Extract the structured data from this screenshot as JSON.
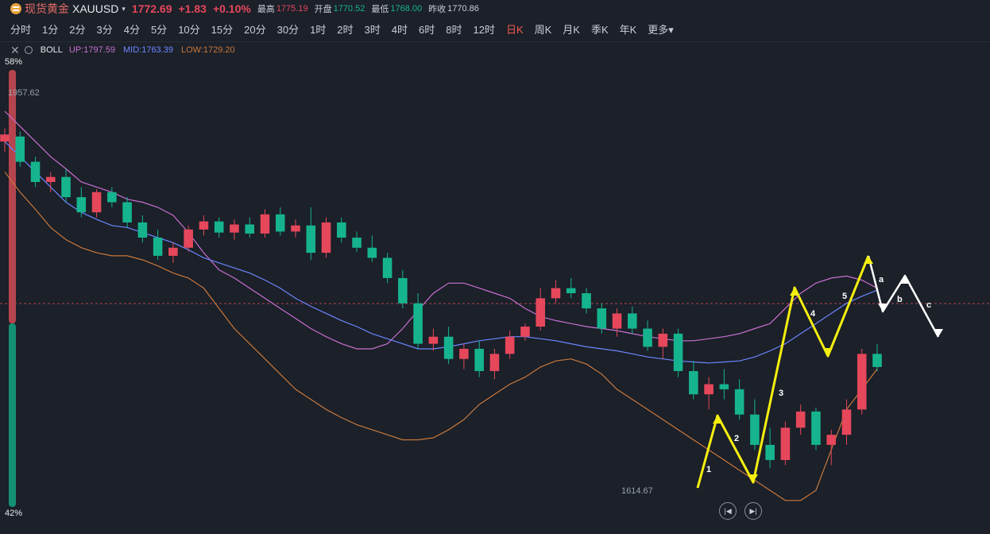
{
  "header": {
    "name": "现货黄金",
    "code": "XAUUSD",
    "caret": "▾",
    "price": "1772.69",
    "change": "+1.83",
    "change_pct": "+0.10%",
    "high_label": "最高",
    "high": "1775.19",
    "open_label": "开盘",
    "open": "1770.52",
    "low_label": "最低",
    "low": "1768.00",
    "prev_label": "昨收",
    "prev": "1770.86"
  },
  "timeframes": [
    "分时",
    "1分",
    "2分",
    "3分",
    "4分",
    "5分",
    "10分",
    "15分",
    "20分",
    "30分",
    "1时",
    "2时",
    "3时",
    "4时",
    "6时",
    "8时",
    "12时",
    "日K",
    "周K",
    "月K",
    "季K",
    "年K",
    "更多"
  ],
  "active_timeframe": "日K",
  "indicator": {
    "name": "BOLL",
    "up": "UP:1797.59",
    "mid": "MID:1763.39",
    "low": "LOW:1729.20"
  },
  "side_percent": {
    "top": "58%",
    "bottom": "42%",
    "top_value": 0.58
  },
  "colors": {
    "bull": "#e6475b",
    "bear": "#16b48e",
    "upper": "#c86fd0",
    "mid": "#6c86ff",
    "lower": "#c9783d",
    "wave": "#f5ef0f",
    "corr": "#ffffff"
  },
  "chart_data": {
    "type": "candlestick",
    "title": "",
    "max_label": "1957.62",
    "min_label": "1614.67",
    "wave_labels": [
      "1",
      "2",
      "3",
      "4",
      "5",
      "a",
      "b",
      "c"
    ],
    "bollinger": {
      "upper": [
        1975,
        1960,
        1945,
        1930,
        1918,
        1905,
        1900,
        1895,
        1888,
        1885,
        1880,
        1872,
        1855,
        1835,
        1818,
        1810,
        1800,
        1790,
        1780,
        1770,
        1760,
        1752,
        1745,
        1740,
        1740,
        1745,
        1760,
        1778,
        1795,
        1805,
        1805,
        1800,
        1795,
        1790,
        1780,
        1772,
        1768,
        1765,
        1762,
        1760,
        1758,
        1755,
        1752,
        1750,
        1748,
        1748,
        1750,
        1752,
        1755,
        1760,
        1765,
        1780,
        1795,
        1805,
        1810,
        1812,
        1808,
        1800
      ],
      "mid": [
        1945,
        1930,
        1915,
        1900,
        1885,
        1875,
        1868,
        1862,
        1860,
        1855,
        1850,
        1845,
        1838,
        1830,
        1825,
        1820,
        1815,
        1808,
        1800,
        1790,
        1782,
        1775,
        1768,
        1762,
        1755,
        1750,
        1745,
        1740,
        1740,
        1742,
        1745,
        1748,
        1750,
        1752,
        1752,
        1750,
        1748,
        1745,
        1742,
        1740,
        1738,
        1735,
        1732,
        1730,
        1728,
        1727,
        1726,
        1727,
        1728,
        1732,
        1738,
        1745,
        1755,
        1765,
        1775,
        1785,
        1792,
        1798
      ],
      "lower": [
        1915,
        1895,
        1878,
        1860,
        1848,
        1840,
        1835,
        1832,
        1832,
        1828,
        1822,
        1815,
        1810,
        1800,
        1780,
        1760,
        1745,
        1730,
        1715,
        1700,
        1690,
        1680,
        1672,
        1665,
        1660,
        1655,
        1650,
        1650,
        1652,
        1660,
        1670,
        1685,
        1695,
        1705,
        1712,
        1722,
        1728,
        1730,
        1725,
        1715,
        1700,
        1690,
        1680,
        1670,
        1660,
        1650,
        1640,
        1630,
        1620,
        1610,
        1600,
        1590,
        1590,
        1600,
        1640,
        1680,
        1700,
        1720
      ]
    },
    "candles": [
      {
        "o": 1945,
        "h": 1958,
        "l": 1935,
        "c": 1952
      },
      {
        "o": 1950,
        "h": 1955,
        "l": 1920,
        "c": 1925
      },
      {
        "o": 1925,
        "h": 1930,
        "l": 1900,
        "c": 1905
      },
      {
        "o": 1905,
        "h": 1915,
        "l": 1895,
        "c": 1910
      },
      {
        "o": 1910,
        "h": 1918,
        "l": 1885,
        "c": 1890
      },
      {
        "o": 1890,
        "h": 1900,
        "l": 1870,
        "c": 1875
      },
      {
        "o": 1875,
        "h": 1898,
        "l": 1870,
        "c": 1895
      },
      {
        "o": 1895,
        "h": 1900,
        "l": 1880,
        "c": 1885
      },
      {
        "o": 1885,
        "h": 1890,
        "l": 1860,
        "c": 1865
      },
      {
        "o": 1865,
        "h": 1872,
        "l": 1845,
        "c": 1850
      },
      {
        "o": 1850,
        "h": 1858,
        "l": 1828,
        "c": 1832
      },
      {
        "o": 1832,
        "h": 1845,
        "l": 1825,
        "c": 1840
      },
      {
        "o": 1840,
        "h": 1862,
        "l": 1836,
        "c": 1858
      },
      {
        "o": 1858,
        "h": 1872,
        "l": 1852,
        "c": 1866
      },
      {
        "o": 1866,
        "h": 1870,
        "l": 1850,
        "c": 1855
      },
      {
        "o": 1855,
        "h": 1868,
        "l": 1848,
        "c": 1863
      },
      {
        "o": 1863,
        "h": 1870,
        "l": 1850,
        "c": 1854
      },
      {
        "o": 1854,
        "h": 1878,
        "l": 1850,
        "c": 1873
      },
      {
        "o": 1873,
        "h": 1880,
        "l": 1852,
        "c": 1856
      },
      {
        "o": 1856,
        "h": 1868,
        "l": 1850,
        "c": 1862
      },
      {
        "o": 1862,
        "h": 1880,
        "l": 1828,
        "c": 1835
      },
      {
        "o": 1835,
        "h": 1870,
        "l": 1830,
        "c": 1865
      },
      {
        "o": 1865,
        "h": 1870,
        "l": 1845,
        "c": 1850
      },
      {
        "o": 1850,
        "h": 1856,
        "l": 1836,
        "c": 1840
      },
      {
        "o": 1840,
        "h": 1852,
        "l": 1826,
        "c": 1830
      },
      {
        "o": 1830,
        "h": 1835,
        "l": 1805,
        "c": 1810
      },
      {
        "o": 1810,
        "h": 1818,
        "l": 1780,
        "c": 1785
      },
      {
        "o": 1785,
        "h": 1795,
        "l": 1740,
        "c": 1745
      },
      {
        "o": 1745,
        "h": 1760,
        "l": 1738,
        "c": 1752
      },
      {
        "o": 1752,
        "h": 1762,
        "l": 1725,
        "c": 1730
      },
      {
        "o": 1730,
        "h": 1745,
        "l": 1720,
        "c": 1740
      },
      {
        "o": 1740,
        "h": 1748,
        "l": 1712,
        "c": 1718
      },
      {
        "o": 1718,
        "h": 1740,
        "l": 1710,
        "c": 1735
      },
      {
        "o": 1735,
        "h": 1758,
        "l": 1730,
        "c": 1752
      },
      {
        "o": 1752,
        "h": 1765,
        "l": 1748,
        "c": 1762
      },
      {
        "o": 1762,
        "h": 1800,
        "l": 1758,
        "c": 1790
      },
      {
        "o": 1790,
        "h": 1808,
        "l": 1785,
        "c": 1800
      },
      {
        "o": 1800,
        "h": 1810,
        "l": 1790,
        "c": 1795
      },
      {
        "o": 1795,
        "h": 1800,
        "l": 1775,
        "c": 1780
      },
      {
        "o": 1780,
        "h": 1785,
        "l": 1755,
        "c": 1760
      },
      {
        "o": 1760,
        "h": 1780,
        "l": 1752,
        "c": 1775
      },
      {
        "o": 1775,
        "h": 1782,
        "l": 1755,
        "c": 1760
      },
      {
        "o": 1760,
        "h": 1768,
        "l": 1738,
        "c": 1742
      },
      {
        "o": 1742,
        "h": 1760,
        "l": 1730,
        "c": 1755
      },
      {
        "o": 1755,
        "h": 1760,
        "l": 1712,
        "c": 1718
      },
      {
        "o": 1718,
        "h": 1728,
        "l": 1690,
        "c": 1695
      },
      {
        "o": 1695,
        "h": 1712,
        "l": 1680,
        "c": 1705
      },
      {
        "o": 1705,
        "h": 1720,
        "l": 1690,
        "c": 1700
      },
      {
        "o": 1700,
        "h": 1710,
        "l": 1670,
        "c": 1675
      },
      {
        "o": 1675,
        "h": 1690,
        "l": 1640,
        "c": 1645
      },
      {
        "o": 1645,
        "h": 1662,
        "l": 1622,
        "c": 1630
      },
      {
        "o": 1630,
        "h": 1668,
        "l": 1625,
        "c": 1662
      },
      {
        "o": 1662,
        "h": 1685,
        "l": 1655,
        "c": 1678
      },
      {
        "o": 1678,
        "h": 1682,
        "l": 1640,
        "c": 1645
      },
      {
        "o": 1645,
        "h": 1660,
        "l": 1625,
        "c": 1655
      },
      {
        "o": 1655,
        "h": 1690,
        "l": 1645,
        "c": 1680
      },
      {
        "o": 1680,
        "h": 1740,
        "l": 1675,
        "c": 1735
      },
      {
        "o": 1735,
        "h": 1745,
        "l": 1718,
        "c": 1722
      }
    ]
  }
}
